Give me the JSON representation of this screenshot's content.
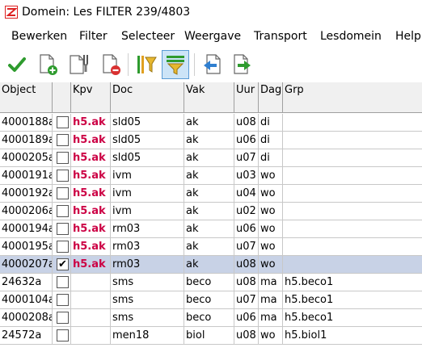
{
  "window": {
    "title": "Domein: Les FILTER  239/4803"
  },
  "menu": [
    "Bewerken",
    "Filter",
    "Selecteer",
    "Weergave",
    "Transport",
    "Lesdomein",
    "Help"
  ],
  "toolbar": {
    "buttons": [
      {
        "name": "apply-check-icon"
      },
      {
        "name": "new-document-icon"
      },
      {
        "name": "tools-document-icon"
      },
      {
        "name": "delete-document-icon"
      },
      {
        "name": "filter-bars-icon"
      },
      {
        "name": "filter-active-icon",
        "active": true
      },
      {
        "name": "export-left-icon"
      },
      {
        "name": "export-right-icon"
      }
    ]
  },
  "grid": {
    "columns": [
      "Object",
      "",
      "Kpv",
      "Doc",
      "Vak",
      "Uur",
      "Dag",
      "Grp"
    ],
    "rows": [
      {
        "object": "4000188a",
        "checked": false,
        "kpv": "h5.ak",
        "doc": "sld05",
        "vak": "ak",
        "uur": "u08",
        "dag": "di",
        "grp": ""
      },
      {
        "object": "4000189a",
        "checked": false,
        "kpv": "h5.ak",
        "doc": "sld05",
        "vak": "ak",
        "uur": "u06",
        "dag": "di",
        "grp": ""
      },
      {
        "object": "4000205a",
        "checked": false,
        "kpv": "h5.ak",
        "doc": "sld05",
        "vak": "ak",
        "uur": "u07",
        "dag": "di",
        "grp": ""
      },
      {
        "object": "4000191a",
        "checked": false,
        "kpv": "h5.ak",
        "doc": "ivm",
        "vak": "ak",
        "uur": "u03",
        "dag": "wo",
        "grp": ""
      },
      {
        "object": "4000192a",
        "checked": false,
        "kpv": "h5.ak",
        "doc": "ivm",
        "vak": "ak",
        "uur": "u04",
        "dag": "wo",
        "grp": ""
      },
      {
        "object": "4000206a",
        "checked": false,
        "kpv": "h5.ak",
        "doc": "ivm",
        "vak": "ak",
        "uur": "u02",
        "dag": "wo",
        "grp": ""
      },
      {
        "object": "4000194a",
        "checked": false,
        "kpv": "h5.ak",
        "doc": "rm03",
        "vak": "ak",
        "uur": "u06",
        "dag": "wo",
        "grp": ""
      },
      {
        "object": "4000195a",
        "checked": false,
        "kpv": "h5.ak",
        "doc": "rm03",
        "vak": "ak",
        "uur": "u07",
        "dag": "wo",
        "grp": ""
      },
      {
        "object": "4000207a",
        "checked": true,
        "selected": true,
        "kpv": "h5.ak",
        "doc": "rm03",
        "vak": "ak",
        "uur": "u08",
        "dag": "wo",
        "grp": ""
      },
      {
        "object": "24632a",
        "checked": false,
        "kpv": "",
        "doc": "sms",
        "vak": "beco",
        "uur": "u08",
        "dag": "ma",
        "grp": "h5.beco1"
      },
      {
        "object": "4000104a",
        "checked": false,
        "kpv": "",
        "doc": "sms",
        "vak": "beco",
        "uur": "u07",
        "dag": "ma",
        "grp": "h5.beco1"
      },
      {
        "object": "4000208a",
        "checked": false,
        "kpv": "",
        "doc": "sms",
        "vak": "beco",
        "uur": "u06",
        "dag": "ma",
        "grp": "h5.beco1"
      },
      {
        "object": "24572a",
        "checked": false,
        "kpv": "",
        "doc": "men18",
        "vak": "biol",
        "uur": "u08",
        "dag": "wo",
        "grp": "h5.biol1"
      }
    ]
  },
  "colors": {
    "kpv_text": "#cc0044",
    "selected_row": "#c8d2e6",
    "header_bg": "#f0f0f0"
  }
}
